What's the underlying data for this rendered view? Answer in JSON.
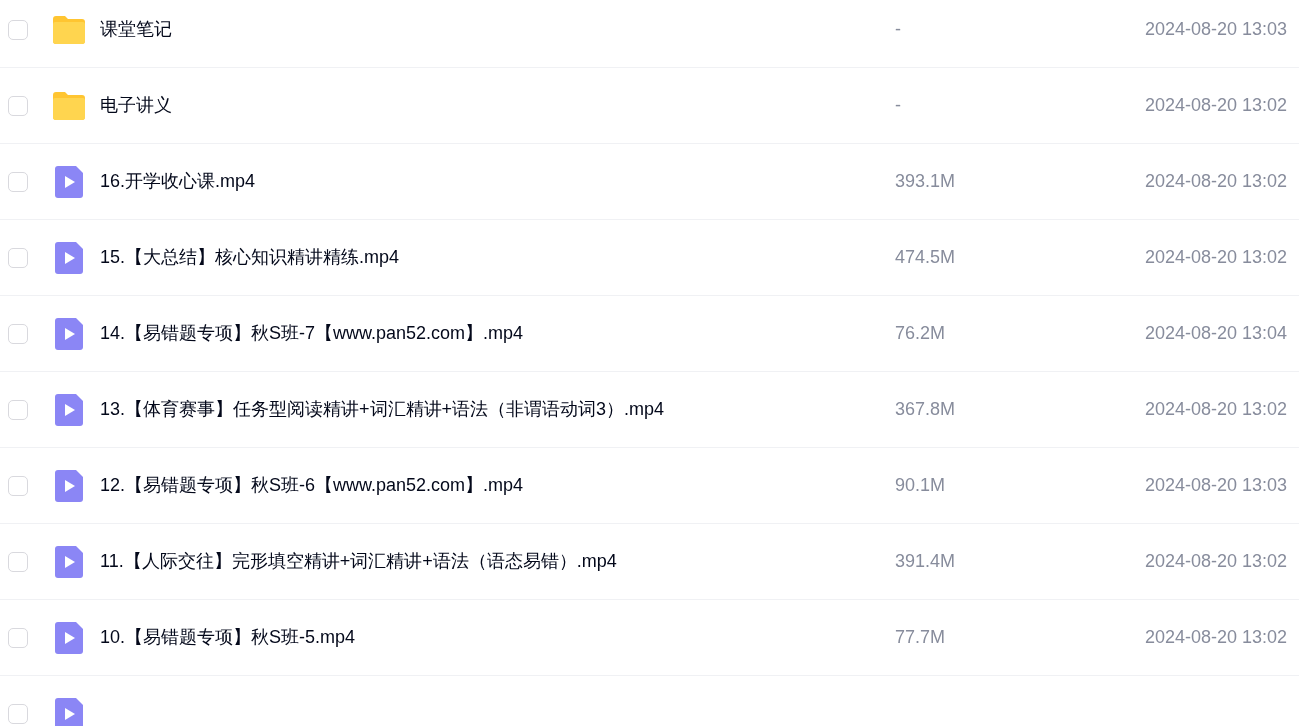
{
  "files": [
    {
      "kind": "folder",
      "name": "课堂笔记",
      "size": "-",
      "modified": "2024-08-20 13:03",
      "checked": false
    },
    {
      "kind": "folder",
      "name": "电子讲义",
      "size": "-",
      "modified": "2024-08-20 13:02",
      "checked": false
    },
    {
      "kind": "video",
      "name": "16.开学收心课.mp4",
      "size": "393.1M",
      "modified": "2024-08-20 13:02",
      "checked": false
    },
    {
      "kind": "video",
      "name": "15.【大总结】核心知识精讲精练.mp4",
      "size": "474.5M",
      "modified": "2024-08-20 13:02",
      "checked": false
    },
    {
      "kind": "video",
      "name": "14.【易错题专项】秋S班-7【www.pan52.com】.mp4",
      "size": "76.2M",
      "modified": "2024-08-20 13:04",
      "checked": false
    },
    {
      "kind": "video",
      "name": "13.【体育赛事】任务型阅读精讲+词汇精讲+语法（非谓语动词3）.mp4",
      "size": "367.8M",
      "modified": "2024-08-20 13:02",
      "checked": false
    },
    {
      "kind": "video",
      "name": "12.【易错题专项】秋S班-6【www.pan52.com】.mp4",
      "size": "90.1M",
      "modified": "2024-08-20 13:03",
      "checked": false
    },
    {
      "kind": "video",
      "name": "11.【人际交往】完形填空精讲+词汇精讲+语法（语态易错）.mp4",
      "size": "391.4M",
      "modified": "2024-08-20 13:02",
      "checked": false
    },
    {
      "kind": "video",
      "name": "10.【易错题专项】秋S班-5.mp4",
      "size": "77.7M",
      "modified": "2024-08-20 13:02",
      "checked": false
    },
    {
      "kind": "video",
      "checked": false
    }
  ]
}
